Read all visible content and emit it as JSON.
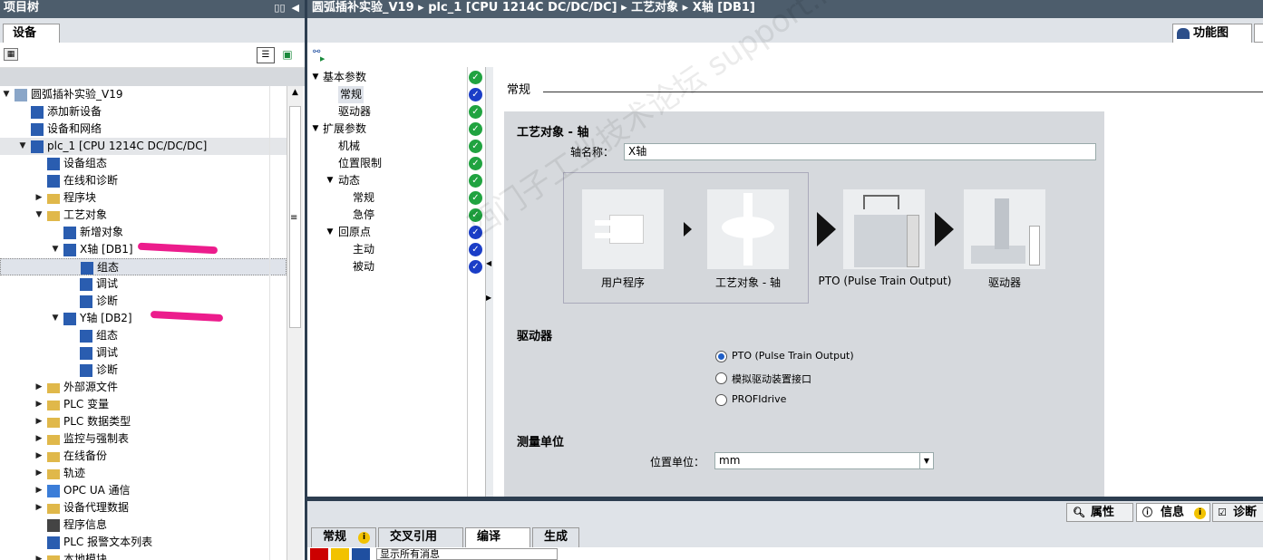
{
  "left": {
    "title": "项目树",
    "tab": "设备",
    "tree": [
      {
        "label": "圆弧插补实验_V19",
        "indent": 0,
        "arrow": "▼",
        "icon": "project",
        "state": ""
      },
      {
        "label": "添加新设备",
        "indent": 1,
        "arrow": "",
        "icon": "add-device",
        "state": ""
      },
      {
        "label": "设备和网络",
        "indent": 1,
        "arrow": "",
        "icon": "network",
        "state": ""
      },
      {
        "label": "plc_1 [CPU 1214C DC/DC/DC]",
        "indent": 1,
        "arrow": "▼",
        "icon": "plc",
        "state": "hl"
      },
      {
        "label": "设备组态",
        "indent": 2,
        "arrow": "",
        "icon": "device-config",
        "state": ""
      },
      {
        "label": "在线和诊断",
        "indent": 2,
        "arrow": "",
        "icon": "online-diag",
        "state": ""
      },
      {
        "label": "程序块",
        "indent": 2,
        "arrow": "▶",
        "icon": "folder",
        "state": ""
      },
      {
        "label": "工艺对象",
        "indent": 2,
        "arrow": "▼",
        "icon": "folder",
        "state": ""
      },
      {
        "label": "新增对象",
        "indent": 3,
        "arrow": "",
        "icon": "add-object",
        "state": ""
      },
      {
        "label": "X轴 [DB1]",
        "indent": 3,
        "arrow": "▼",
        "icon": "axis",
        "state": ""
      },
      {
        "label": "组态",
        "indent": 4,
        "arrow": "",
        "icon": "config",
        "state": "sel"
      },
      {
        "label": "调试",
        "indent": 4,
        "arrow": "",
        "icon": "commissioning",
        "state": ""
      },
      {
        "label": "诊断",
        "indent": 4,
        "arrow": "",
        "icon": "diagnostics",
        "state": ""
      },
      {
        "label": "Y轴 [DB2]",
        "indent": 3,
        "arrow": "▼",
        "icon": "axis",
        "state": ""
      },
      {
        "label": "组态",
        "indent": 4,
        "arrow": "",
        "icon": "config",
        "state": ""
      },
      {
        "label": "调试",
        "indent": 4,
        "arrow": "",
        "icon": "commissioning",
        "state": ""
      },
      {
        "label": "诊断",
        "indent": 4,
        "arrow": "",
        "icon": "diagnostics",
        "state": ""
      },
      {
        "label": "外部源文件",
        "indent": 2,
        "arrow": "▶",
        "icon": "folder",
        "state": ""
      },
      {
        "label": "PLC 变量",
        "indent": 2,
        "arrow": "▶",
        "icon": "folder",
        "state": ""
      },
      {
        "label": "PLC 数据类型",
        "indent": 2,
        "arrow": "▶",
        "icon": "folder",
        "state": ""
      },
      {
        "label": "监控与强制表",
        "indent": 2,
        "arrow": "▶",
        "icon": "folder",
        "state": ""
      },
      {
        "label": "在线备份",
        "indent": 2,
        "arrow": "▶",
        "icon": "folder",
        "state": ""
      },
      {
        "label": "轨迹",
        "indent": 2,
        "arrow": "▶",
        "icon": "folder",
        "state": ""
      },
      {
        "label": "OPC UA 通信",
        "indent": 2,
        "arrow": "▶",
        "icon": "opcua",
        "state": ""
      },
      {
        "label": "设备代理数据",
        "indent": 2,
        "arrow": "▶",
        "icon": "folder",
        "state": ""
      },
      {
        "label": "程序信息",
        "indent": 2,
        "arrow": "",
        "icon": "program-info",
        "state": ""
      },
      {
        "label": "PLC 报警文本列表",
        "indent": 2,
        "arrow": "",
        "icon": "alarm-text",
        "state": ""
      },
      {
        "label": "本地模块",
        "indent": 2,
        "arrow": "▶",
        "icon": "folder",
        "state": ""
      }
    ]
  },
  "editor": {
    "breadcrumb": "圆弧插补实验_V19 ▸ plc_1 [CPU 1214C DC/DC/DC] ▸ 工艺对象 ▸ X轴 [DB1]",
    "tab_label": "功能图",
    "nav": [
      {
        "label": "基本参数",
        "level": 0,
        "arrow": "▼",
        "status": "ok"
      },
      {
        "label": "常规",
        "level": 1,
        "arrow": "",
        "status": "blue",
        "selected": true
      },
      {
        "label": "驱动器",
        "level": 1,
        "arrow": "",
        "status": "ok"
      },
      {
        "label": "扩展参数",
        "level": 0,
        "arrow": "▼",
        "status": "ok"
      },
      {
        "label": "机械",
        "level": 1,
        "arrow": "",
        "status": "ok"
      },
      {
        "label": "位置限制",
        "level": 1,
        "arrow": "",
        "status": "ok"
      },
      {
        "label": "动态",
        "level": 1,
        "arrow": "▼",
        "status": "ok"
      },
      {
        "label": "常规",
        "level": 2,
        "arrow": "",
        "status": "ok"
      },
      {
        "label": "急停",
        "level": 2,
        "arrow": "",
        "status": "ok"
      },
      {
        "label": "回原点",
        "level": 1,
        "arrow": "▼",
        "status": "blue"
      },
      {
        "label": "主动",
        "level": 2,
        "arrow": "",
        "status": "blue"
      },
      {
        "label": "被动",
        "level": 2,
        "arrow": "",
        "status": "blue"
      }
    ],
    "section_title": "常规",
    "panel_title": "工艺对象 - 轴",
    "axis_name_label": "轴名称：",
    "axis_name_value": "X轴",
    "diagram": {
      "user_program": "用户程序",
      "tech_object": "工艺对象 - 轴",
      "pto": "PTO (Pulse Train Output)",
      "drive": "驱动器"
    },
    "drive_heading": "驱动器",
    "drive_options": [
      {
        "label": "PTO (Pulse Train Output)",
        "selected": true
      },
      {
        "label": "模拟驱动装置接口",
        "selected": false
      },
      {
        "label": "PROFIdrive",
        "selected": false
      }
    ],
    "unit_heading": "测量单位",
    "position_unit_label": "位置单位：",
    "position_unit_value": "mm",
    "watermark": "西门子工业技术论坛 support.industry.siemens.com/cs"
  },
  "inspector": {
    "properties": "属性",
    "info": "信息",
    "diagnostics": "诊断",
    "tabs": [
      "常规",
      "交叉引用",
      "编译",
      "生成"
    ],
    "active_tab": "编译",
    "filter": "显示所有消息"
  },
  "colors": {
    "titlebar": "#4d5d6c",
    "ok": "#20a340",
    "blue": "#1b3ec7",
    "highlight_pen": "#ec1c8c"
  }
}
